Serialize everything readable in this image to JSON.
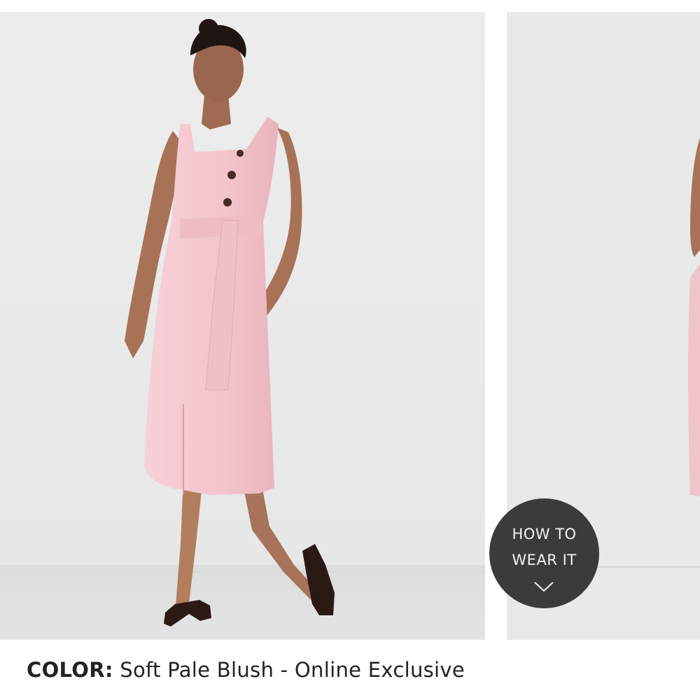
{
  "gallery": {
    "images": [
      {
        "icon": "product-photo-model-front",
        "alt": ""
      },
      {
        "icon": "product-photo-model-side-cropped",
        "alt": ""
      }
    ],
    "how_to_wear": {
      "line1": "HOW TO",
      "line2": "WEAR IT",
      "icon": "chevron-down-icon"
    }
  },
  "product": {
    "color_label": "COLOR:",
    "color_value": "Soft Pale Blush - Online Exclusive"
  },
  "colors": {
    "dress": "#f4c7cf",
    "background": "#eaeaea",
    "badge": "#3b3b3b",
    "text": "#222222"
  }
}
